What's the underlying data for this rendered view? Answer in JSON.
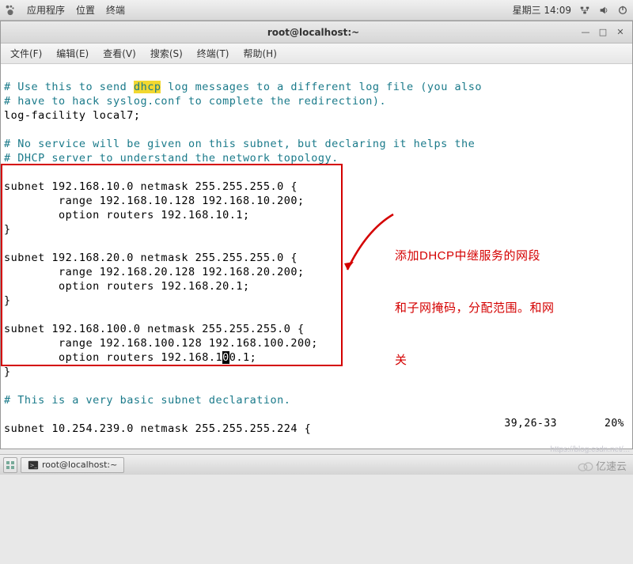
{
  "top_panel": {
    "apps": "应用程序",
    "places": "位置",
    "terminal": "终端",
    "datetime": "星期三 14:09"
  },
  "window": {
    "title": "root@localhost:~"
  },
  "menubar": {
    "file": "文件(F)",
    "edit": "编辑(E)",
    "view": "查看(V)",
    "search": "搜索(S)",
    "terminal": "终端(T)",
    "help": "帮助(H)"
  },
  "content": {
    "l1a": "# Use this to send ",
    "l1_hl": "dhcp",
    "l1b": " log messages to a different log file (you also",
    "l2": "# have to hack syslog.conf to complete the redirection).",
    "l3": "log-facility local7;",
    "l4": "",
    "l5": "# No service will be given on this subnet, but declaring it helps the",
    "l6": "# DHCP server to understand the network topology.",
    "l7": "",
    "l8": "subnet 192.168.10.0 netmask 255.255.255.0 {",
    "l9": "        range 192.168.10.128 192.168.10.200;",
    "l10": "        option routers 192.168.10.1;",
    "l11": "}",
    "l12": "",
    "l13": "subnet 192.168.20.0 netmask 255.255.255.0 {",
    "l14": "        range 192.168.20.128 192.168.20.200;",
    "l15": "        option routers 192.168.20.1;",
    "l16": "}",
    "l17": "",
    "l18": "subnet 192.168.100.0 netmask 255.255.255.0 {",
    "l19": "        range 192.168.100.128 192.168.100.200;",
    "l20a": "        option routers 192.168.1",
    "l20_cur": "0",
    "l20b": "0.1;",
    "l21": "}",
    "l22": "",
    "l23": "# This is a very basic subnet declaration.",
    "l24": "",
    "l25": "subnet 10.254.239.0 netmask 255.255.255.224 {"
  },
  "annotation": {
    "line1": "添加DHCP中继服务的网段",
    "line2": "和子网掩码，分配范围。和网",
    "line3": "关"
  },
  "status": {
    "pos": "39,26-33",
    "pct": "20%"
  },
  "taskbar": {
    "active": "root@localhost:~"
  },
  "watermark": {
    "blog": "https://blog.csdn.net/...",
    "logo": "亿速云"
  }
}
